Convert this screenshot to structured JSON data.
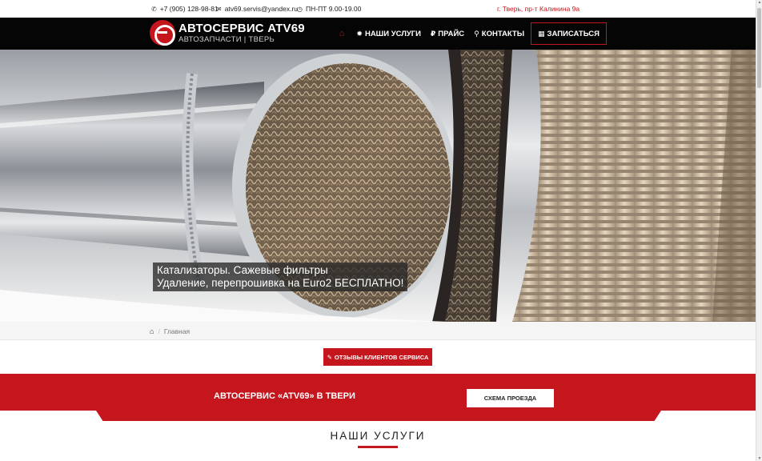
{
  "topbar": {
    "phone": "+7 (905) 128-98-81",
    "email": "atv69.servis@yandex.ru",
    "hours": "ПН-ПТ 9.00-19.00",
    "address": "г. Тверь, пр-т Калинина 9а",
    "icons": [
      "phone-icon",
      "envelope-icon",
      "clock-icon"
    ]
  },
  "header": {
    "logo_title": "АВТОСЕРВИС ATV69",
    "logo_subtitle": "АВТОЗАПЧАСТИ | ТВЕРЬ",
    "nav": {
      "home_icon": "⌂",
      "services": "НАШИ УСЛУГИ",
      "price": "ПРАЙС",
      "contacts": "КОНТАКТЫ",
      "signup": "ЗАПИСАТЬСЯ"
    },
    "nav_icons": [
      "home-icon",
      "gear-icon",
      "ruble-icon",
      "map-marker-icon",
      "calendar-icon"
    ]
  },
  "hero": {
    "line1": "Катализаторы. Сажевые фильтры",
    "line2": "Удаление, перепрошивка на Euro2 БЕСПЛАТНО!"
  },
  "breadcrumb": {
    "separator": "/",
    "current": "Главная"
  },
  "reviews_button": "ОТЗЫВЫ КЛИЕНТОВ СЕРВИСА",
  "band": {
    "title": "АВТОСЕРВИС «ATV69» В ТВЕРИ",
    "map_button": "СХЕМА ПРОЕЗДА"
  },
  "services_title": "НАШИ УСЛУГИ",
  "colors": {
    "accent": "#c4161c",
    "header_bg": "#050505"
  }
}
